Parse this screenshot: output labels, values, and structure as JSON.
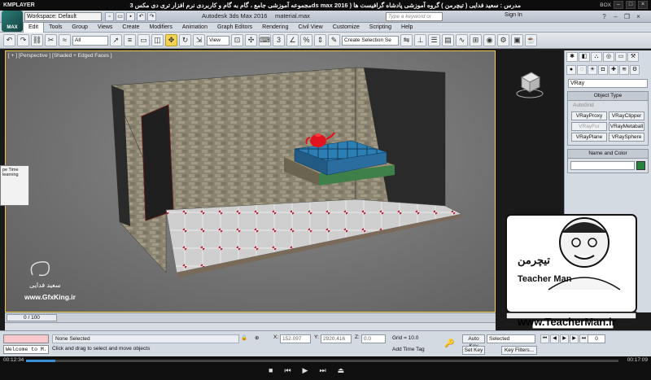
{
  "player": {
    "brand": "KMPLAYER",
    "title": "مجموعه آموزشی جامع ، گام به گام و کاربردی نرم افزار تری دی مکس 3ds max 2016 ) مدرس : سعید فدایی ( تیچرمن ) گروه آموزشی پادشاه گرافیست ها",
    "right_label": "BOX",
    "time_current": "00:12:34",
    "time_total": "00:17:09",
    "progress": 0.05
  },
  "titlebar": {
    "workspace": "Workspace: Default",
    "app_title": "Autodesk 3ds Max 2016",
    "file_name": "material.max",
    "search_placeholder": "Type a keyword or phrase",
    "sign_in": "Sign In"
  },
  "menu": [
    "Edit",
    "Tools",
    "Group",
    "Views",
    "Create",
    "Modifiers",
    "Animation",
    "Graph Editors",
    "Rendering",
    "Civil View",
    "Customize",
    "Scripting",
    "Help"
  ],
  "toolbar": {
    "filter": "All",
    "ref_coord": "View",
    "selection_set": "Create Selection Se"
  },
  "viewport": {
    "label": "[ + ] [Perspective ] [Shaded + Edged Faces ]"
  },
  "command_panel": {
    "category": "VRay",
    "object_type_title": "Object Type",
    "autogrid": "AutoGrid",
    "buttons": [
      "VRayProxy",
      "VRayClipper",
      "VRayFur",
      "VRayMetaball",
      "VRayPlane",
      "VRaySphere"
    ],
    "name_color_title": "Name and Color",
    "swatch_color": "#23843a"
  },
  "timeline": {
    "frame": "0 / 100"
  },
  "status": {
    "maxscript": "Welcome to M.",
    "selection": "None Selected",
    "prompt": "Click and drag to select and move objects",
    "x_label": "X:",
    "x_value": "152.097",
    "y_label": "Y:",
    "y_value": "2920.416",
    "z_label": "Z:",
    "z_value": "0.0",
    "grid": "Grid = 10.0",
    "add_time_tag": "Add Time Tag",
    "auto_key": "Auto Key",
    "set_key": "Set Key",
    "selected": "Selected",
    "key_filters": "Key Filters...",
    "frame_value": "0"
  },
  "watermark": {
    "gfx_name": "سعید فدایی",
    "gfx_url": "www.GfxKing.ir",
    "tm_url": "www.TeacherMan.ir",
    "tm_name": "Teacher Man",
    "tm_fa": "تیچرمن"
  },
  "dialog": {
    "line1": "pe Time",
    "line2": "learning"
  }
}
